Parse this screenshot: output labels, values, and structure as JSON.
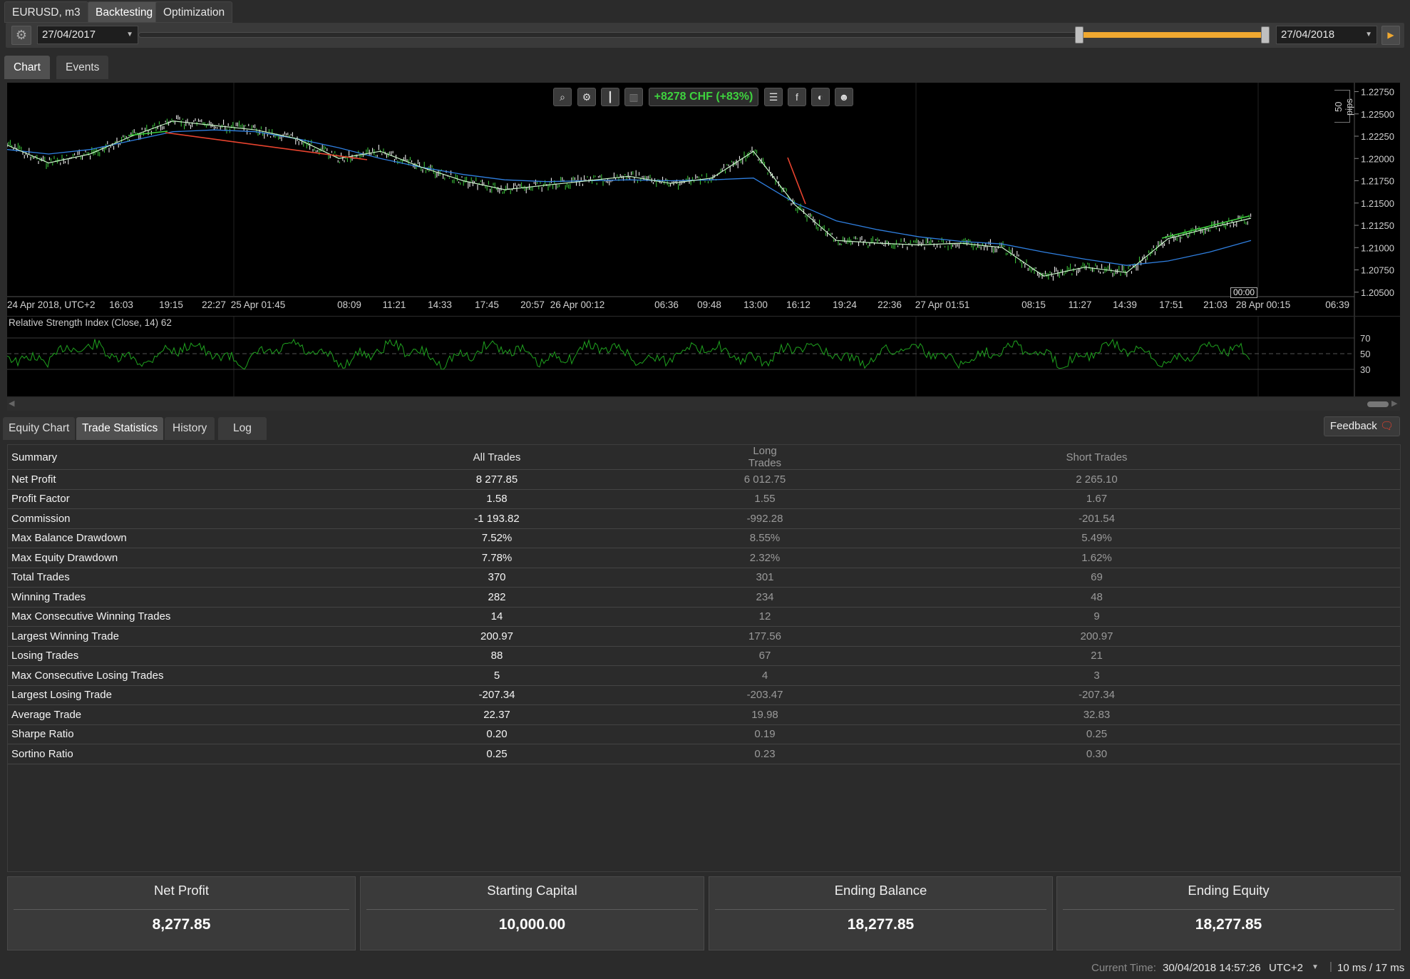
{
  "top_tabs": {
    "symbol": "EURUSD, m3",
    "backtesting": "Backtesting",
    "optimization": "Optimization"
  },
  "date_range": {
    "start": "27/04/2017",
    "end": "27/04/2018"
  },
  "chart_tabs": {
    "chart": "Chart",
    "events": "Events"
  },
  "chart": {
    "profit_badge": "+8278 CHF (+83%)",
    "pips_label": "50 pips",
    "crosshair_time": "00:00",
    "rsi_label": "Relative Strength Index (Close, 14) 62",
    "rsi_levels": [
      "70",
      "50",
      "30"
    ]
  },
  "chart_data": {
    "type": "line",
    "y_ticks": [
      "1.22750",
      "1.22500",
      "1.22250",
      "1.22000",
      "1.21750",
      "1.21500",
      "1.21250",
      "1.21000",
      "1.20750",
      "1.20500"
    ],
    "ylim": [
      1.2045,
      1.2285
    ],
    "x_ticks": [
      "24 Apr 2018, UTC+2",
      "16:03",
      "19:15",
      "22:27",
      "25 Apr 01:45",
      "08:09",
      "11:21",
      "14:33",
      "17:45",
      "20:57",
      "26 Apr 00:12",
      "06:36",
      "09:48",
      "13:00",
      "16:12",
      "19:24",
      "22:36",
      "27 Apr 01:51",
      "08:15",
      "11:27",
      "14:39",
      "17:51",
      "21:03",
      "28 Apr 00:15",
      "06:39"
    ],
    "series": [
      {
        "values": [
          1.2215,
          1.2195,
          1.2205,
          1.2225,
          1.2242,
          1.2237,
          1.2232,
          1.2222,
          1.22,
          1.2208,
          1.219,
          1.2175,
          1.2165,
          1.217,
          1.2175,
          1.218,
          1.2172,
          1.2178,
          1.2208,
          1.2148,
          1.2108,
          1.2105,
          1.2103,
          1.2105,
          1.21,
          1.2068,
          1.2078,
          1.2072,
          1.211,
          1.2122,
          1.2133
        ]
      },
      {
        "values": [
          1.221,
          1.2205,
          1.221,
          1.222,
          1.223,
          1.2232,
          1.223,
          1.2222,
          1.2212,
          1.22,
          1.219,
          1.2182,
          1.2176,
          1.2174,
          1.2175,
          1.2176,
          1.2175,
          1.2176,
          1.2178,
          1.215,
          1.213,
          1.212,
          1.2112,
          1.2107,
          1.2104,
          1.2095,
          1.2087,
          1.208,
          1.2085,
          1.2095,
          1.2108
        ]
      }
    ]
  },
  "bottom_tabs": {
    "equity": "Equity Chart",
    "stats": "Trade Statistics",
    "history": "History",
    "log": "Log",
    "feedback": "Feedback"
  },
  "stats": {
    "headers": [
      "Summary",
      "All Trades",
      "Long Trades",
      "Short Trades"
    ],
    "rows": [
      [
        "Net Profit",
        "8 277.85",
        "6 012.75",
        "2 265.10"
      ],
      [
        "Profit Factor",
        "1.58",
        "1.55",
        "1.67"
      ],
      [
        "Commission",
        "-1 193.82",
        "-992.28",
        "-201.54"
      ],
      [
        "Max Balance Drawdown",
        "7.52%",
        "8.55%",
        "5.49%"
      ],
      [
        "Max Equity Drawdown",
        "7.78%",
        "2.32%",
        "1.62%"
      ],
      [
        "Total Trades",
        "370",
        "301",
        "69"
      ],
      [
        "Winning Trades",
        "282",
        "234",
        "48"
      ],
      [
        "Max Consecutive Winning Trades",
        "14",
        "12",
        "9"
      ],
      [
        "Largest Winning Trade",
        "200.97",
        "177.56",
        "200.97"
      ],
      [
        "Losing Trades",
        "88",
        "67",
        "21"
      ],
      [
        "Max Consecutive Losing Trades",
        "5",
        "4",
        "3"
      ],
      [
        "Largest Losing Trade",
        "-207.34",
        "-203.47",
        "-207.34"
      ],
      [
        "Average Trade",
        "22.37",
        "19.98",
        "32.83"
      ],
      [
        "Sharpe Ratio",
        "0.20",
        "0.19",
        "0.25"
      ],
      [
        "Sortino Ratio",
        "0.25",
        "0.23",
        "0.30"
      ]
    ]
  },
  "summary_cards": [
    {
      "label": "Net Profit",
      "value": "8,277.85"
    },
    {
      "label": "Starting Capital",
      "value": "10,000.00"
    },
    {
      "label": "Ending Balance",
      "value": "18,277.85"
    },
    {
      "label": "Ending Equity",
      "value": "18,277.85"
    }
  ],
  "status": {
    "current_time_label": "Current Time:",
    "current_time": "30/04/2018 14:57:26",
    "timezone": "UTC+2",
    "latency": "10 ms / 17 ms"
  },
  "colors": {
    "accent": "#f0a830",
    "profit_green": "#3ed13e",
    "ma_blue": "#2f7fe0",
    "price_line": "#c8f5c8",
    "rsi_green": "#1fa31f",
    "trade_red": "#e8432e"
  }
}
